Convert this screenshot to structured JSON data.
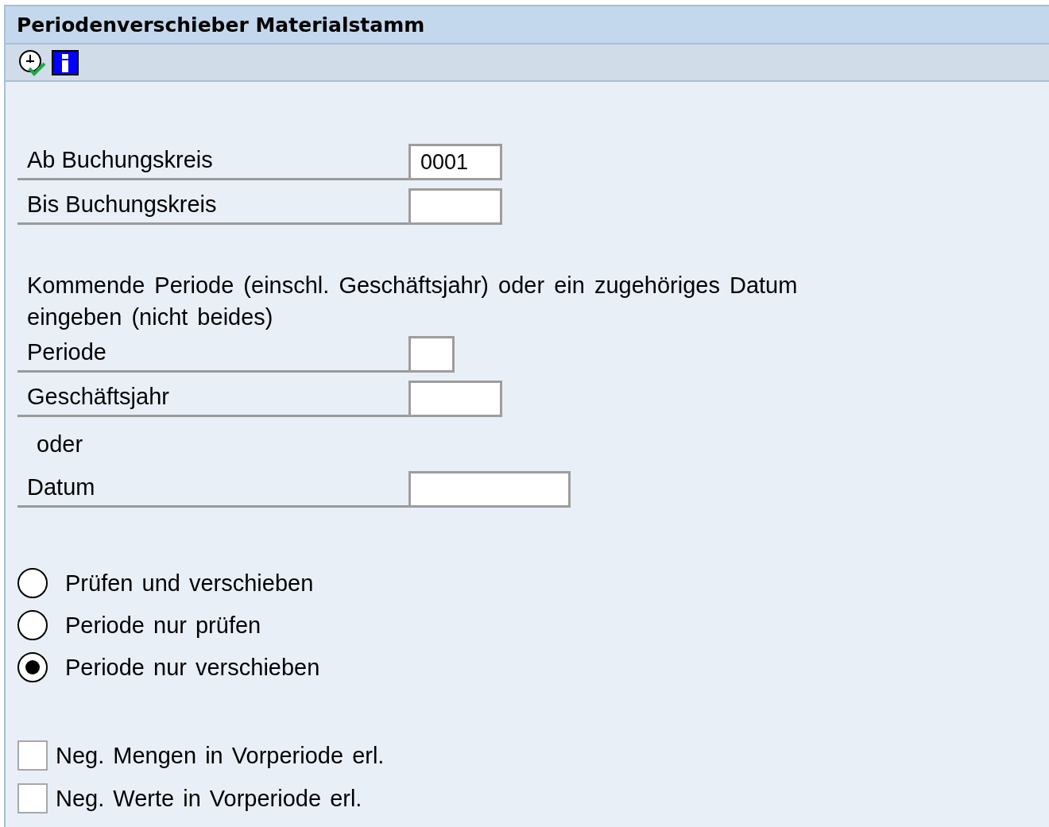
{
  "window": {
    "title": "Periodenverschieber Materialstamm"
  },
  "company_fields": [
    {
      "label": "Ab Buchungskreis",
      "value": "0001"
    },
    {
      "label": "Bis Buchungskreis"
    }
  ],
  "instruction": "Kommende Periode (einschl. Geschäftsjahr) oder ein zugehöriges Datum eingeben (nicht beides)",
  "period_fields": [
    {
      "kind": "field",
      "label": "Periode"
    },
    {
      "kind": "field",
      "label": "Geschäftsjahr"
    },
    {
      "kind": "separator",
      "label": "oder"
    },
    {
      "kind": "field",
      "label": "Datum"
    }
  ],
  "modes": [
    {
      "label": "Prüfen und verschieben",
      "selected": false
    },
    {
      "label": "Periode nur prüfen",
      "selected": false
    },
    {
      "label": "Periode nur verschieben",
      "selected": true
    }
  ],
  "options": [
    {
      "label": "Neg. Mengen in Vorperiode erl.",
      "checked": false
    },
    {
      "label": "Neg. Werte in Vorperiode erl.",
      "checked": false
    }
  ]
}
